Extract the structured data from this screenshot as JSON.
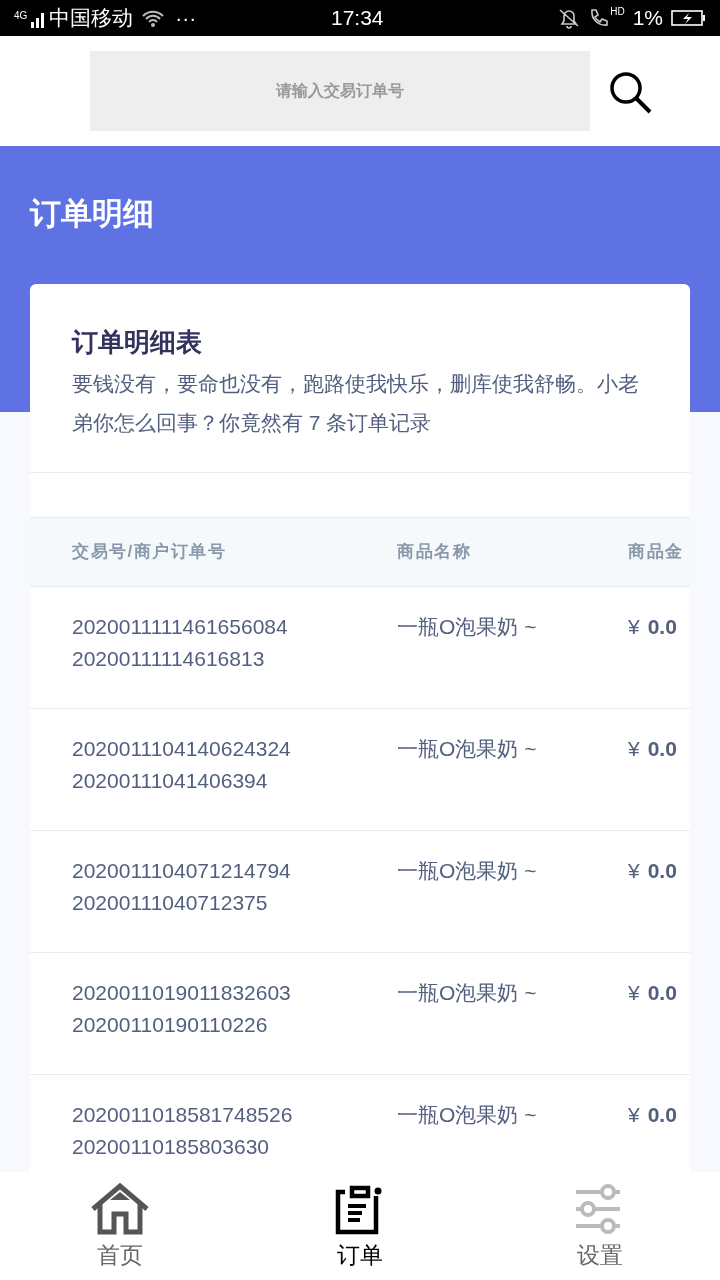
{
  "status_bar": {
    "network": "4G",
    "carrier": "中国移动",
    "more": "···",
    "time": "17:34",
    "hd": "HD",
    "battery": "1%"
  },
  "search": {
    "placeholder": "请输入交易订单号"
  },
  "header": {
    "title": "订单明细"
  },
  "card": {
    "title": "订单明细表",
    "description": "要钱没有，要命也没有，跑路使我快乐，删库使我舒畅。小老弟你怎么回事？你竟然有 7 条订单记录"
  },
  "table": {
    "columns": [
      "交易号/商户订单号",
      "商品名称",
      "商品金"
    ],
    "rows": [
      {
        "trade_no": "2020011111461656084",
        "order_no": "20200111114616813",
        "product": "一瓶O泡果奶 ~",
        "currency": "¥",
        "amount": "0.0"
      },
      {
        "trade_no": "2020011104140624324",
        "order_no": "20200111041406394",
        "product": "一瓶O泡果奶 ~",
        "currency": "¥",
        "amount": "0.0"
      },
      {
        "trade_no": "2020011104071214794",
        "order_no": "20200111040712375",
        "product": "一瓶O泡果奶 ~",
        "currency": "¥",
        "amount": "0.0"
      },
      {
        "trade_no": "2020011019011832603",
        "order_no": "20200110190110226",
        "product": "一瓶O泡果奶 ~",
        "currency": "¥",
        "amount": "0.0"
      },
      {
        "trade_no": "2020011018581748526",
        "order_no": "20200110185803630",
        "product": "一瓶O泡果奶 ~",
        "currency": "¥",
        "amount": "0.0"
      }
    ]
  },
  "tab_bar": [
    {
      "kind": "home",
      "label": "首页",
      "selected": false
    },
    {
      "kind": "orders",
      "label": "订单",
      "selected": true
    },
    {
      "kind": "settings",
      "label": "设置",
      "selected": false
    }
  ]
}
